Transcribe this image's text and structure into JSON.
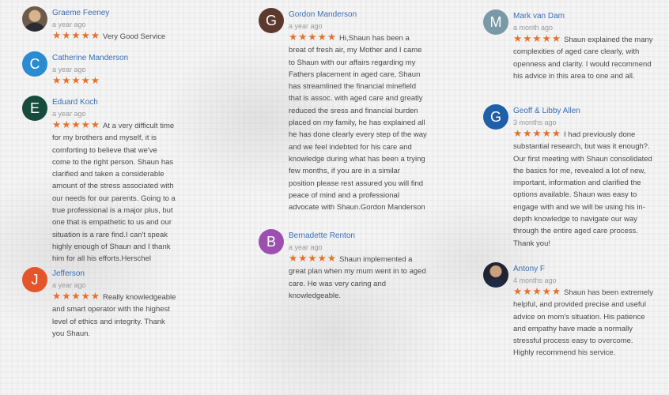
{
  "columns": [
    [
      {
        "name": "Graeme Feeney",
        "time": "a year ago",
        "text": "Very Good Service",
        "avatar": {
          "initial": "",
          "color": "#6c5a4a",
          "type": "photo"
        }
      },
      {
        "name": "Catherine Manderson",
        "time": "a year ago",
        "text": "",
        "avatar": {
          "initial": "C",
          "color": "#2a8bd1",
          "type": "letter"
        }
      },
      {
        "name": "Eduard Koch",
        "time": "a year ago",
        "text": "At a very difficult time for my brothers and myself, it is comforting to believe that we've come to the right person. Shaun has clarified and taken a considerable amount of the stress associated with our needs for our parents. Going to a true professional is a major plus, but one that is empathetic to us and our situation is a rare find.I can't speak highly enough of Shaun and I thank him for all his efforts.Herschel",
        "avatar": {
          "initial": "E",
          "color": "#174c3d",
          "type": "letter"
        }
      },
      {
        "name": "Jefferson",
        "time": "a year ago",
        "text": "Really knowledgeable and smart operator with the highest level of ethics and integrity. Thank you Shaun.",
        "avatar": {
          "initial": "J",
          "color": "#e4552b",
          "type": "letter"
        }
      }
    ],
    [
      {
        "name": "Gordon Manderson",
        "time": "a year ago",
        "text": "Hi,Shaun has been a breat of fresh air, my Mother and I came to Shaun with our affairs regarding my Fathers placement in aged care, Shaun has streamlined the financial minefield that is assoc. with aged care and greatly reduced the sress and financial burden placed on my family, he has explained all he has done clearly every step of the way and we feel indebted for his care and knowledge during what has been a trying few months, if you are in a similar position please rest assured you will find peace of mind and a professional advocate with Shaun.Gordon Manderson",
        "avatar": {
          "initial": "G",
          "color": "#5b3a2d",
          "type": "letter"
        }
      },
      {
        "name": "Bernadette Renton",
        "time": "a year ago",
        "text": "Shaun implemented a great plan when my mum went in to aged care. He was very caring and knowledgeable.",
        "avatar": {
          "initial": "B",
          "color": "#9c4fb0",
          "type": "letter"
        }
      }
    ],
    [
      {
        "name": "Mark van Dam",
        "time": "a month ago",
        "text": "Shaun explained the many complexities of aged care clearly, with openness and clarity. I would recommend his advice in this area to one and all.",
        "avatar": {
          "initial": "M",
          "color": "#7a99a6",
          "type": "letter"
        }
      },
      {
        "name": "Geoff & Libby Allen",
        "time": "3 months ago",
        "text": "I had previously done substantial research, but was it enough?. Our first meeting with Shaun consolidated the basics for me, revealed a lot of new, important, information and clarified the options available. Shaun was easy to engage with and we will be using his in-depth knowledge to navigate our way through the entire aged care process. Thank you!",
        "avatar": {
          "initial": "G",
          "color": "#1f5ea8",
          "type": "letter"
        }
      },
      {
        "name": "Antony F",
        "time": "4 months ago",
        "text": "Shaun has been extremely helpful, and provided precise and useful advice on mom's situation. His patience and empathy have made a normally stressful process easy to overcome. Highly recommend his service.",
        "avatar": {
          "initial": "",
          "color": "#1f2430",
          "type": "photo2"
        }
      }
    ]
  ],
  "rating": {
    "stars": 5,
    "glyph": "★★★★★",
    "color": "#e8702a"
  }
}
